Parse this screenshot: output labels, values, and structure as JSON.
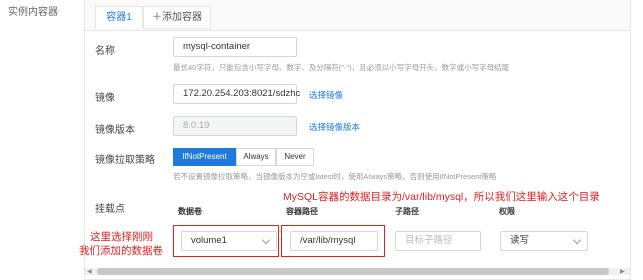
{
  "section_label": "实例内容器",
  "tabs": [
    {
      "label": "容器1"
    },
    {
      "label": "添加容器"
    }
  ],
  "name": {
    "label": "名称",
    "value": "mysql-container",
    "hint": "最长40字符，只能包含小写字母、数字、及分隔符(\"-\")，且必须以小写字母开头，数字或小写字母结尾"
  },
  "image": {
    "label": "镜像",
    "value": "172.20.254.203:8021/sdzhc",
    "link": "选择镜像"
  },
  "image_version": {
    "label": "镜像版本",
    "value": "8.0.19",
    "link": "选择镜像版本"
  },
  "pull_policy": {
    "label": "镜像拉取策略",
    "options": [
      "IfNotPresent",
      "Always",
      "Never"
    ],
    "selected": "IfNotPresent",
    "hint": "若不设置镜像拉取策略，当镜像版本为空或latest时，使用Always策略，否则使用IfNotPresent策略"
  },
  "mount": {
    "label": "挂载点",
    "columns": [
      "数据卷",
      "容器路径",
      "子路径",
      "权限"
    ],
    "row": {
      "volume": "volume1",
      "container_path": "/var/lib/mysql",
      "subpath_placeholder": "目标子路径",
      "permission": "读写"
    }
  },
  "annotations": {
    "top": "MySQL容器的数据目录为/var/lib/mysql，所以我们这里输入这个目录",
    "left_line1": "这里选择刚刚",
    "left_line2": "我们添加的数据卷"
  },
  "colors": {
    "accent": "#1e7bdc",
    "annotation": "#e02020"
  }
}
